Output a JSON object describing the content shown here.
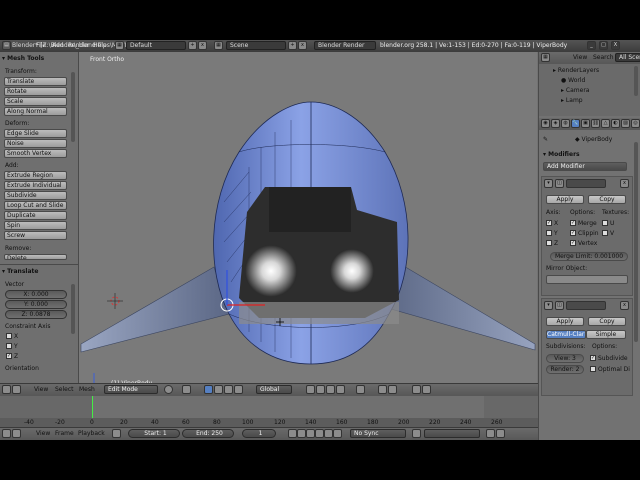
{
  "window": {
    "title": "Blender* [Z:\\Blender\\_blend files\\MkVII_Viper_1.blend]",
    "controls": [
      "_",
      "□",
      "X"
    ]
  },
  "info_header": {
    "menus": [
      "File",
      "Add",
      "Render",
      "Help"
    ],
    "layout": "Default",
    "scene": "Scene",
    "engine": "Blender Render",
    "stats": "blender.org 258.1 | Ve:1-153 | Ed:0-270 | Fa:0-119 | ViperBody"
  },
  "tool_shelf": {
    "title": "Mesh Tools",
    "transform": {
      "label": "Transform:",
      "buttons": [
        "Translate",
        "Rotate",
        "Scale",
        "Along Normal"
      ]
    },
    "deform": {
      "label": "Deform:",
      "buttons": [
        "Edge Slide",
        "Noise",
        "Smooth Vertex"
      ]
    },
    "add": {
      "label": "Add:",
      "buttons": [
        "Extrude Region",
        "Extrude Individual",
        "Subdivide",
        "Loop Cut and Slide",
        "Duplicate",
        "Spin",
        "Screw"
      ]
    },
    "remove": {
      "label": "Remove:",
      "button": "Delete"
    },
    "operator": {
      "title": "Translate",
      "vector_label": "Vector",
      "x": "X: 0.000",
      "y": "Y: 0.000",
      "z": "Z: 0.0878",
      "constraint_label": "Constraint Axis",
      "axes": [
        "X",
        "Y",
        "Z"
      ],
      "axes_checked": [
        false,
        false,
        true
      ],
      "orientation_label": "Orientation"
    }
  },
  "viewport": {
    "view_name": "Front Ortho",
    "object_name": "(1) ViperBody"
  },
  "view3d_header": {
    "menus": [
      "View",
      "Select",
      "Mesh"
    ],
    "mode": "Edit Mode",
    "orientation": "Global"
  },
  "timeline": {
    "ticks": [
      "-40",
      "-20",
      "0",
      "20",
      "40",
      "60",
      "80",
      "100",
      "120",
      "140",
      "160",
      "180",
      "200",
      "220",
      "240",
      "260"
    ],
    "current_frame": 0
  },
  "timeline_header": {
    "menus": [
      "View",
      "Frame",
      "Playback"
    ],
    "start": "Start: 1",
    "end": "End: 250",
    "frame": "1",
    "sync": "No Sync"
  },
  "outliner": {
    "header": {
      "menus": [
        "View",
        "Search"
      ],
      "filter": "All Scenes"
    },
    "items": [
      "RenderLayers",
      "World",
      "Camera",
      "Lamp"
    ]
  },
  "properties": {
    "object": "ViperBody",
    "panel_title": "Modifiers",
    "add_modifier": "Add Modifier",
    "mirror": {
      "apply": "Apply",
      "copy": "Copy",
      "axis_label": "Axis:",
      "options_label": "Options:",
      "textures_label": "Textures:",
      "axes": [
        "X",
        "Y",
        "Z"
      ],
      "options": [
        "Merge",
        "Clippin",
        "Vertex"
      ],
      "textures": [
        "U",
        "V"
      ],
      "merge_limit": "Merge Limit: 0.001000",
      "mirror_object_label": "Mirror Object:"
    },
    "subsurf": {
      "apply": "Apply",
      "copy": "Copy",
      "type_active": "Catmull-Clark",
      "type_other": "Simple",
      "subdivisions_label": "Subdivisions:",
      "options_label": "Options:",
      "view": "View: 3",
      "render": "Render: 2",
      "opt1": "Subdivide",
      "opt2": "Optimal Di"
    }
  },
  "colors": {
    "accent": "#5680c2",
    "ship_body": "#6f86c9",
    "panel_bg": "#727272"
  }
}
